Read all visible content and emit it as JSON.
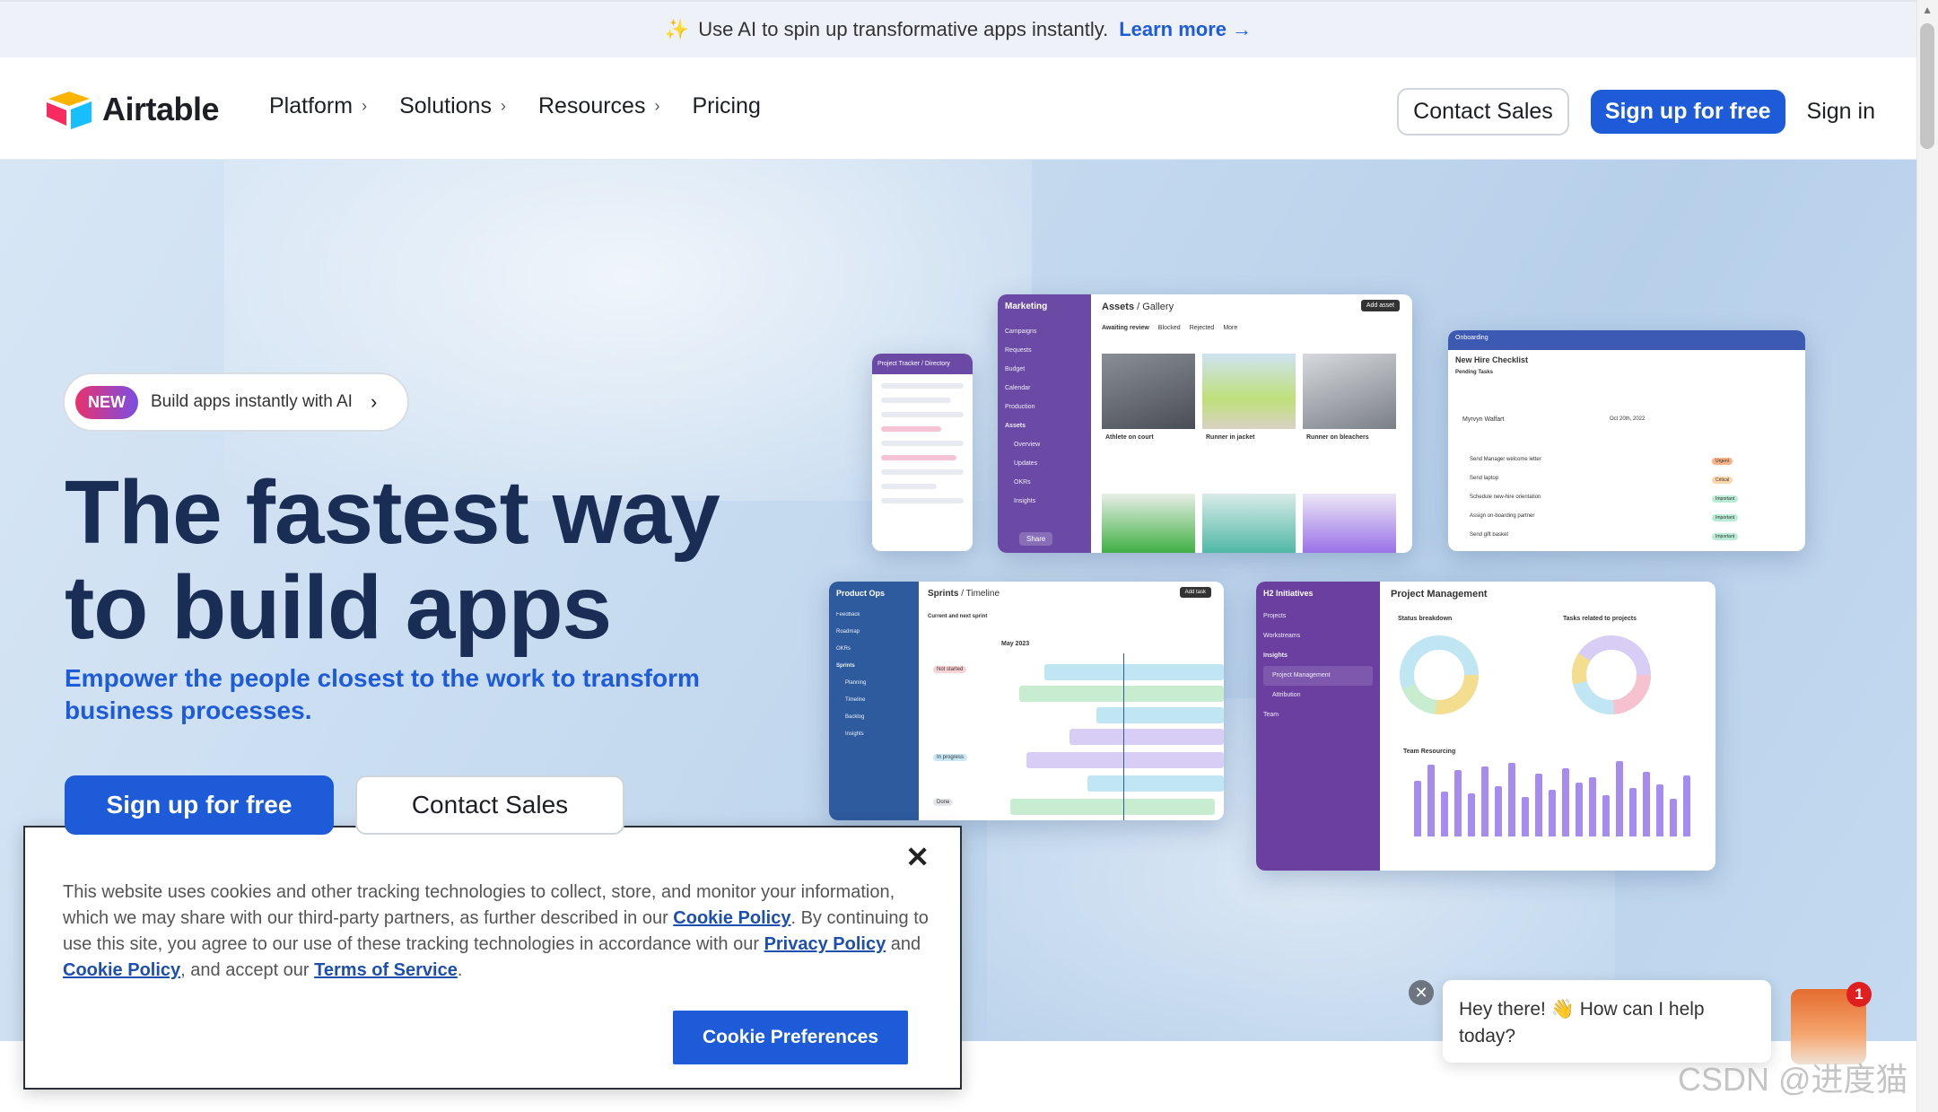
{
  "announcement": {
    "text": "Use AI to spin up transformative apps instantly.",
    "link": "Learn more"
  },
  "nav": {
    "brand": "Airtable",
    "links": [
      "Platform",
      "Solutions",
      "Resources",
      "Pricing"
    ],
    "contact_sales": "Contact Sales",
    "sign_up": "Sign up for free",
    "sign_in": "Sign in"
  },
  "hero": {
    "badge": "NEW",
    "pill_text": "Build apps instantly with AI",
    "title_line1": "The fastest way",
    "title_line2": "to build apps",
    "subtitle": "Empower the people closest to the work to transform business processes.",
    "primary_cta": "Sign up for free",
    "secondary_cta": "Contact Sales"
  },
  "mock": {
    "tracker_title": "Project Tracker / Directory",
    "marketing_title": "Marketing",
    "assets_title": "Assets",
    "gallery_label": "Gallery",
    "add_asset": "Add asset",
    "tabs": [
      "Awaiting review",
      "Blocked",
      "Rejected",
      "More"
    ],
    "marketing_items": [
      "Campaigns",
      "Requests",
      "Budget",
      "Calendar",
      "Production",
      "Assets",
      "Overview",
      "Updates",
      "OKRs",
      "Insights"
    ],
    "gallery_captions": [
      "Athlete on court",
      "Runner in jacket",
      "Runner on bleachers"
    ],
    "share": "Share",
    "onboarding_title": "Onboarding",
    "checklist_title": "New Hire Checklist",
    "pending": "Pending Tasks",
    "employee": "Myrvyn Walfart",
    "start_date": "Oct 20th, 2022",
    "tasks": [
      "Send Manager welcome letter",
      "Send laptop",
      "Schedule new-hire orientation",
      "Assign on-boarding partner",
      "Send gift basket"
    ],
    "priorities": [
      "Urgent",
      "Critical",
      "Important",
      "Important",
      "Important"
    ],
    "product_ops": "Product Ops",
    "product_items": [
      "Feedback",
      "Roadmap",
      "OKRs",
      "Sprints",
      "Planning",
      "Timeline",
      "Backlog",
      "Insights"
    ],
    "sprints_title": "Sprints",
    "timeline_label": "Timeline",
    "add_task": "Add task",
    "current_sprint": "Current and next sprint",
    "month": "May 2023",
    "status_labels": [
      "Not started",
      "In progress",
      "Done"
    ],
    "h2_title": "H2 Initiatives",
    "h2_items": [
      "Projects",
      "Workstreams",
      "Insights",
      "Project Management",
      "Attribution",
      "Team"
    ],
    "pm_title": "Project Management",
    "status_breakdown": "Status breakdown",
    "tasks_related": "Tasks related to projects",
    "team_resourcing": "Team Resourcing",
    "bars": [
      62,
      80,
      50,
      74,
      48,
      78,
      56,
      82,
      44,
      70,
      52,
      76,
      60,
      66,
      46,
      84,
      54,
      72,
      58,
      42,
      68
    ]
  },
  "cookie": {
    "text_1": "This website uses cookies and other tracking technologies to collect, store, and monitor your information, which we may share with our third-party partners, as further described in our ",
    "link_cookie": "Cookie Policy",
    "text_2": ". By continuing to use this site, you agree to our use of these tracking technologies in accordance with our ",
    "link_privacy": "Privacy Policy",
    "text_3": " and ",
    "link_cookie2": "Cookie Policy",
    "text_4": ", and accept our ",
    "link_terms": "Terms of Service",
    "text_5": ".",
    "button": "Cookie Preferences"
  },
  "chat": {
    "message": "Hey there! 👋 How can I help today?",
    "badge_count": "1"
  },
  "watermark": "CSDN @进度猫"
}
